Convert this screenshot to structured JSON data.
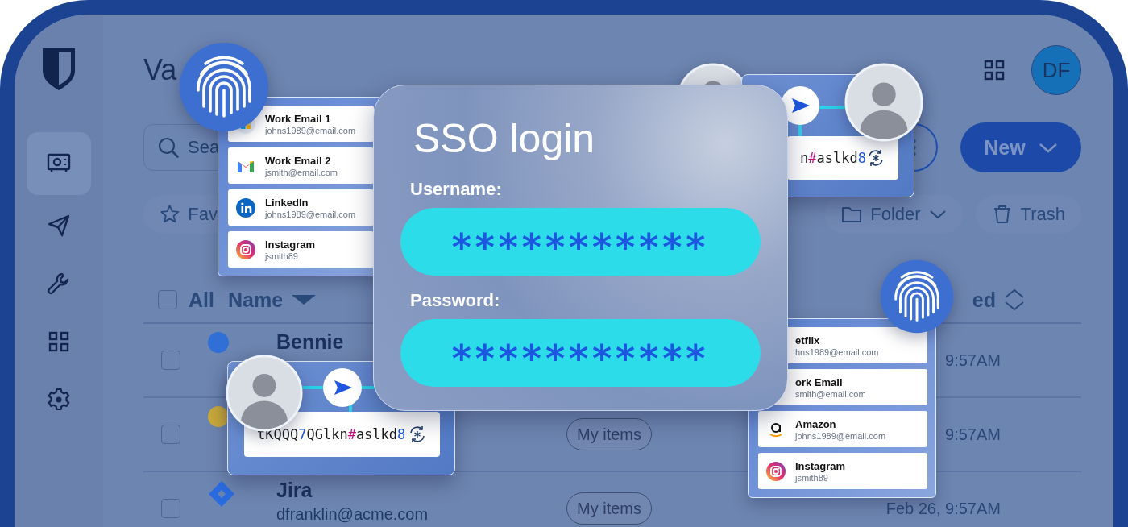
{
  "vault": {
    "sidebar": {
      "items": [
        {
          "kind": "vault",
          "selected": true
        },
        {
          "kind": "send",
          "selected": false
        },
        {
          "kind": "tools",
          "selected": false
        },
        {
          "kind": "apps",
          "selected": false
        },
        {
          "kind": "settings",
          "selected": false
        }
      ]
    },
    "title": "Va",
    "avatar": "DF",
    "search": {
      "placeholder": "Sea"
    },
    "new_button": "New",
    "filters": [
      {
        "kind": "favorites",
        "label": "Fav"
      },
      {
        "kind": "folder",
        "label": "Folder"
      },
      {
        "kind": "trash",
        "label": "Trash"
      }
    ],
    "table": {
      "select_all": {
        "label": "All",
        "checked": false
      },
      "columns": [
        {
          "label": "Name",
          "kind": "sorted"
        },
        {
          "label": "ed",
          "kind": "sortable"
        }
      ],
      "rows": [
        {
          "checked": false,
          "kind": "avatar",
          "color": "#2f6fd6",
          "name": "Bennie",
          "date": "9:57AM"
        },
        {
          "checked": false,
          "kind": "avatar",
          "color": "#c9a93a",
          "owner": "My items",
          "date": "9:57AM"
        },
        {
          "checked": false,
          "kind": "jira",
          "name": "Jira",
          "subtitle": "dfranklin@acme.com",
          "owner": "My items",
          "date": "Feb 26, 9:57AM"
        }
      ]
    }
  },
  "autofill_lists": [
    {
      "items": [
        {
          "kind": "microsoft",
          "name": "Work Email 1",
          "account": "johns1989@email.com"
        },
        {
          "kind": "gmail",
          "name": "Work Email 2",
          "account": "jsmith@email.com"
        },
        {
          "kind": "linkedin",
          "name": "LinkedIn",
          "account": "johns1989@email.com"
        },
        {
          "kind": "instagram",
          "name": "Instagram",
          "account": "jsmith89"
        }
      ]
    },
    {
      "items": [
        {
          "name": "etflix",
          "account": "hns1989@email.com"
        },
        {
          "name": "ork Email",
          "account": "smith@email.com"
        },
        {
          "kind": "amazon",
          "name": "Amazon",
          "account": "johns1989@email.com"
        },
        {
          "kind": "instagram",
          "name": "Instagram",
          "account": "jsmith89"
        }
      ]
    }
  ],
  "sso_login": {
    "title": "SSO login",
    "fields": [
      {
        "label": "Username:",
        "value": "***********"
      },
      {
        "label": "Password:",
        "value": "***********"
      }
    ]
  },
  "shares": [
    {
      "password": [
        {
          "kind": "letter",
          "text": "n"
        },
        {
          "kind": "symbol",
          "text": "#"
        },
        {
          "kind": "letter",
          "text": "aslkd"
        },
        {
          "kind": "digit",
          "text": "8"
        }
      ]
    },
    {
      "password": [
        {
          "kind": "letter",
          "text": "tKQQQ"
        },
        {
          "kind": "digit",
          "text": "7"
        },
        {
          "kind": "letter",
          "text": "QGlkn"
        },
        {
          "kind": "symbol",
          "text": "#"
        },
        {
          "kind": "letter",
          "text": "aslkd"
        },
        {
          "kind": "digit",
          "text": "8"
        }
      ]
    }
  ]
}
